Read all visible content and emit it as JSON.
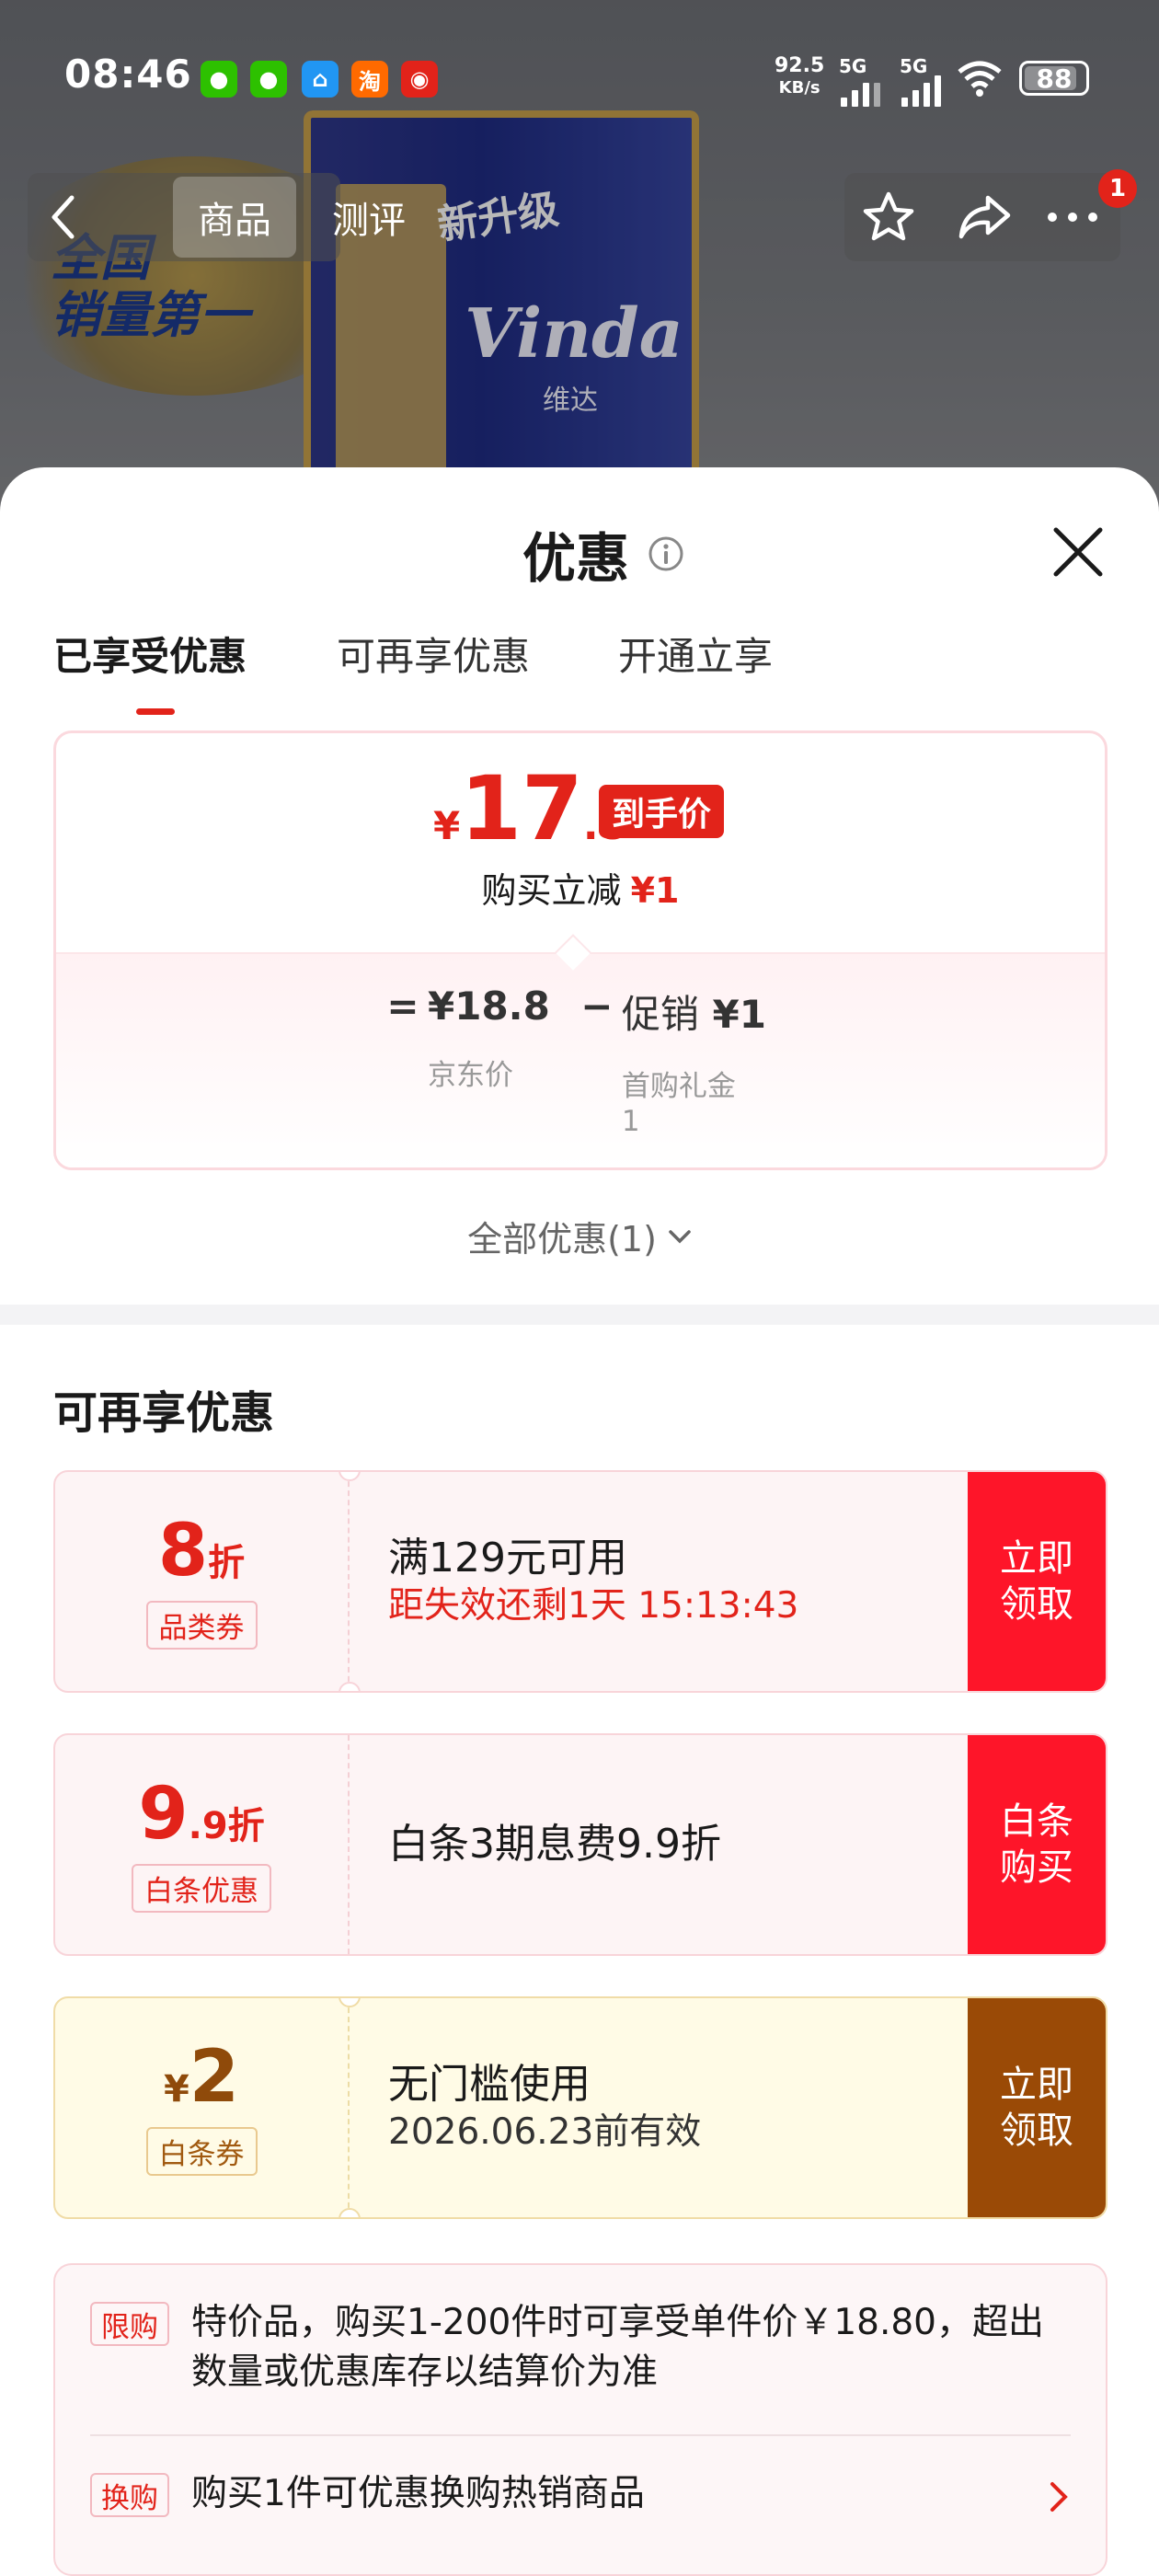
{
  "status_bar": {
    "time": "08:46",
    "net_speed_value": "92.5",
    "net_speed_unit": "KB/s",
    "sim1": "5G",
    "sim2": "5G",
    "battery": "88"
  },
  "top_nav": {
    "tabs": [
      "商品",
      "测评"
    ],
    "active_tab": "商品",
    "badge_count": "1"
  },
  "hero_image": {
    "brand": "Vinda",
    "brand_cn": "维达",
    "badge_text": "新升级",
    "gold_lines": [
      "全国",
      "销量第一"
    ]
  },
  "sheet": {
    "title": "优惠",
    "tabs": [
      "已享受优惠",
      "可再享优惠",
      "开通立享"
    ],
    "active_tab_index": 0,
    "price_card": {
      "currency": "¥",
      "final_int": "17",
      "final_dec": ".8",
      "final_tag": "到手价",
      "reduce_label": "购买立减",
      "reduce_amount": "¥1",
      "eq": "=",
      "minus": "−",
      "jd_price": "¥18.8",
      "jd_label": "京东价",
      "promo_label": "促销",
      "promo_amount": "¥1",
      "promo_sub": "首购礼金",
      "promo_sub_value": "1"
    },
    "all_offers": "全部优惠(1)",
    "section_title": "可再享优惠",
    "coupons": [
      {
        "value_big": "8",
        "value_small": "折",
        "tag": "品类券",
        "main": "满129元可用",
        "sub": "距失效还剩1天 15:13:43",
        "button": "立即领取",
        "style": "red"
      },
      {
        "value_big": "9",
        "value_small": ".9折",
        "tag": "白条优惠",
        "main": "白条3期息费9.9折",
        "sub": "",
        "button": "白条购买",
        "style": "red"
      },
      {
        "value_prefix": "¥",
        "value_big": "2",
        "tag": "白条券",
        "main": "无门槛使用",
        "sub": "2026.06.23前有效",
        "button": "立即领取",
        "style": "gold"
      }
    ],
    "rules": [
      {
        "tag": "限购",
        "text": "特价品，购买1-200件时可享受单件价￥18.80，超出数量或优惠库存以结算价为准"
      },
      {
        "tag": "换购",
        "text": "购买1件可优惠换购热销商品"
      }
    ]
  },
  "colors": {
    "accent": "#e2231a",
    "button_red": "#fe1529",
    "button_brown": "#9a4a06",
    "card_border": "#f8d4d9"
  }
}
